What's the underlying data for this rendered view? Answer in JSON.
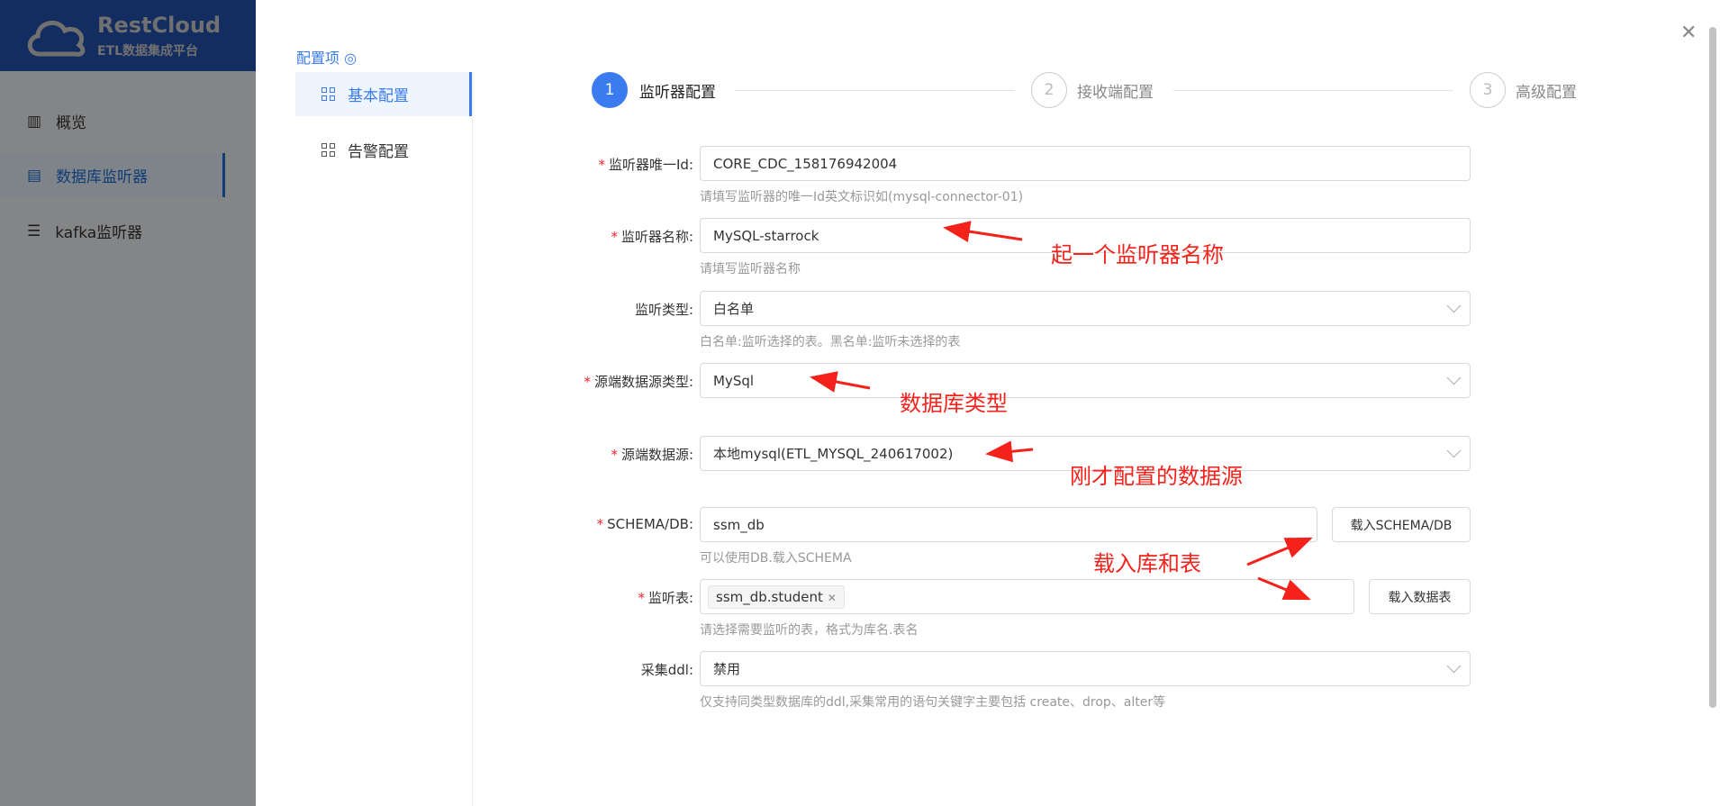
{
  "sidebar": {
    "brand": "RestCloud",
    "brand_sub": "ETL数据集成平台",
    "items": [
      {
        "label": "概览",
        "icon": "bar-chart-icon"
      },
      {
        "label": "数据库监听器",
        "icon": "database-icon"
      },
      {
        "label": "kafka监听器",
        "icon": "list-icon"
      }
    ]
  },
  "drawer": {
    "nav_title": "配置项",
    "nav": [
      {
        "label": "基本配置"
      },
      {
        "label": "告警配置"
      }
    ],
    "steps": [
      {
        "num": "1",
        "label": "监听器配置"
      },
      {
        "num": "2",
        "label": "接收端配置"
      },
      {
        "num": "3",
        "label": "高级配置"
      }
    ],
    "form": {
      "id": {
        "label": "监听器唯一Id:",
        "value": "CORE_CDC_158176942004",
        "hint": "请填写监听器的唯一Id英文标识如(mysql-connector-01)"
      },
      "name": {
        "label": "监听器名称:",
        "value": "MySQL-starrock",
        "hint": "请填写监听器名称"
      },
      "type": {
        "label": "监听类型:",
        "value": "白名单",
        "hint": "白名单:监听选择的表。黑名单:监听未选择的表"
      },
      "srctype": {
        "label": "源端数据源类型:",
        "value": "MySql"
      },
      "src": {
        "label": "源端数据源:",
        "value": "本地mysql(ETL_MYSQL_240617002)"
      },
      "schema": {
        "label": "SCHEMA/DB:",
        "value": "ssm_db",
        "hint": "可以使用DB.载入SCHEMA",
        "button": "载入SCHEMA/DB"
      },
      "tables": {
        "label": "监听表:",
        "tag": "ssm_db.student",
        "hint": "请选择需要监听的表，格式为库名.表名",
        "button": "载入数据表"
      },
      "ddl": {
        "label": "采集ddl:",
        "value": "禁用",
        "hint": "仅支持同类型数据库的ddl,采集常用的语句关键字主要包括 create、drop、alter等"
      }
    },
    "annotations": [
      "起一个监听器名称",
      "数据库类型",
      "刚才配置的数据源",
      "载入库和表"
    ]
  },
  "colors": {
    "primary": "#3a7bf0",
    "annotation": "#f5221b",
    "brand": "#2352b0"
  }
}
